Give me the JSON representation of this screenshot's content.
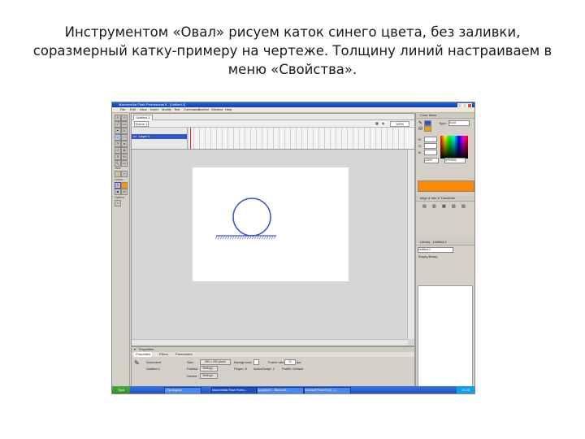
{
  "caption": {
    "line1": "Инструментом «Овал» рисуем каток синего цвета, без заливки,",
    "line2": "соразмерный катку-примеру на чертеже. Толщину линий настраиваем в",
    "line3": "меню «Свойства»."
  },
  "screenshot": {
    "title": "Macromedia Flash Professional 8 - [Untitled-1]",
    "menus": [
      "File",
      "Edit",
      "View",
      "Insert",
      "Modify",
      "Text",
      "Commands",
      "Control",
      "Window",
      "Help"
    ],
    "doc_tab": "Untitled-1",
    "scene": "Scene 1",
    "zoom": "100%",
    "layer_name": "Layer 1",
    "toolbox": {
      "view_label": "View",
      "colors_label": "Colors",
      "options_label": "Options"
    },
    "properties": {
      "header": "Properties",
      "tabs": [
        "Properties",
        "Filters",
        "Parameters"
      ],
      "doc_type": "Document",
      "doc_name": "Untitled-1",
      "size_label": "Size:",
      "size_value": "550 x 400 pixels",
      "background_label": "Background:",
      "framerate_label": "Frame rate:",
      "framerate_value": "12",
      "fps": "fps",
      "publish_label": "Publish:",
      "settings_button": "Settings...",
      "player_label": "Player: 8",
      "actionscript_label": "ActionScript: 2",
      "profile_label": "Profile: Default",
      "devices_label": "Device:",
      "devices_button": "Settings..."
    },
    "right_panel": {
      "color_mixer": "Color Mixer",
      "type_label": "Type:",
      "type_value": "Solid",
      "hex_value": "#FF9900",
      "alpha_value": "100%",
      "align_header": "Align & Info & Transform",
      "components_header": "Library - Untitled-1",
      "library_item": "Untitled-1",
      "empty_library": "Empty library"
    },
    "taskbar": {
      "start": "Пуск",
      "items": [
        "2 Проводник",
        "Macromedia Flash Profes...",
        "Документ1 - Microsoft ...",
        "Microsoft PowerPoint - [..."
      ],
      "clock": "14:25"
    },
    "drawing": {
      "stroke_color": "#3a50c8",
      "ground_color": "#3a50c8"
    }
  }
}
